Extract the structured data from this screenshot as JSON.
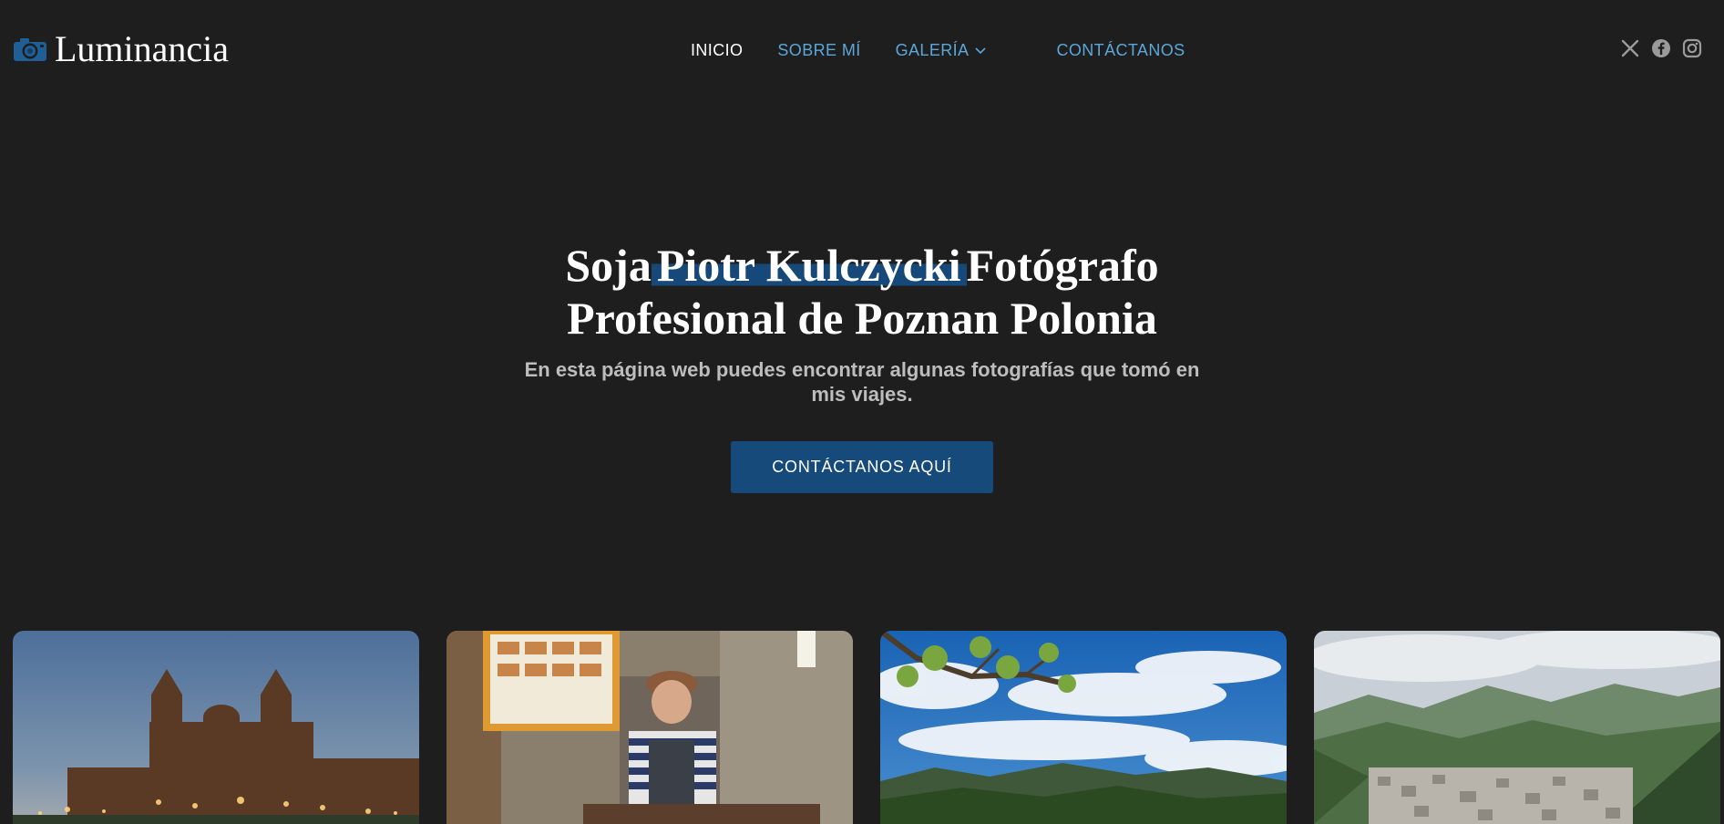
{
  "brand": {
    "name": "Luminancia",
    "icon": "camera-icon",
    "icon_color": "#1f5f96"
  },
  "nav": {
    "items": [
      {
        "label": "INICIO",
        "active": true
      },
      {
        "label": "SOBRE MÍ",
        "active": false
      },
      {
        "label": "GALERÍA",
        "active": false,
        "has_dropdown": true
      },
      {
        "label": "CONTÁCTANOS",
        "active": false
      }
    ]
  },
  "social": [
    "x-icon",
    "facebook-icon",
    "instagram-icon"
  ],
  "hero": {
    "title_prefix": "Soja",
    "title_highlight": "Piotr Kulczycki",
    "title_suffix": "Fotógrafo",
    "title_line2": "Profesional de Poznan Polonia",
    "subtitle": "En esta página web puedes encontrar algunas fotografías que tomó en mis viajes.",
    "cta_label": "CONTÁCTANOS AQUÍ"
  },
  "gallery": [
    {
      "subject": "cathedral-at-dusk"
    },
    {
      "subject": "street-food-vendor"
    },
    {
      "subject": "tree-and-sky-landscape"
    },
    {
      "subject": "mountain-valley-town"
    }
  ],
  "colors": {
    "background": "#1e1e1e",
    "link": "#5ba7d8",
    "accent": "#164a7a",
    "text": "#ffffff",
    "muted_text": "#bdbdbd"
  }
}
